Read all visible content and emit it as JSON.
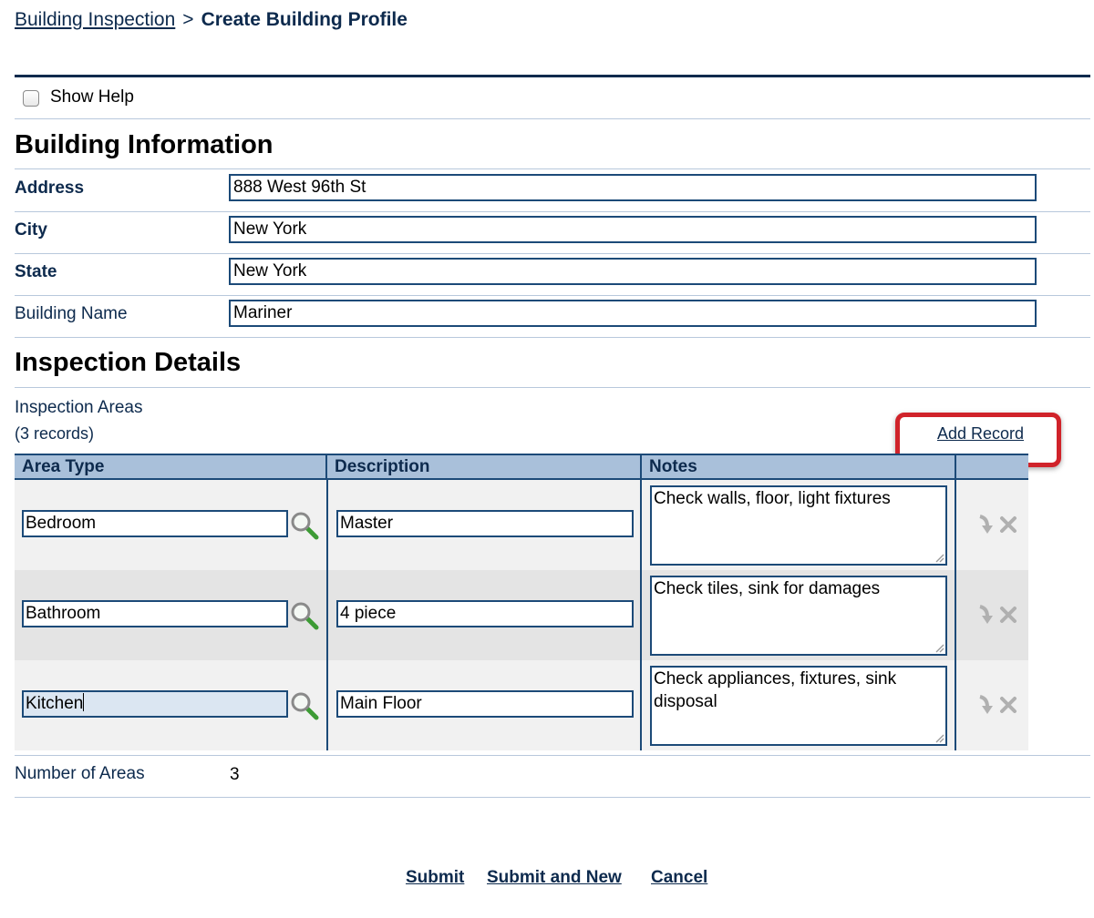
{
  "breadcrumb": {
    "parent": "Building Inspection",
    "separator": ">",
    "current": "Create Building Profile"
  },
  "help": {
    "label": "Show Help",
    "checked": false
  },
  "building_info": {
    "title": "Building Information",
    "fields": [
      {
        "label": "Address",
        "value": "888 West 96th St",
        "required": true
      },
      {
        "label": "City",
        "value": "New York",
        "required": true
      },
      {
        "label": "State",
        "value": "New York",
        "required": true
      },
      {
        "label": "Building Name",
        "value": "Mariner",
        "required": false
      }
    ]
  },
  "inspection": {
    "title": "Inspection Details",
    "areas_label": "Inspection Areas",
    "records_count": "(3 records)",
    "add_record": "Add Record",
    "columns": [
      "Area Type",
      "Description",
      "Notes"
    ],
    "rows": [
      {
        "area_type": "Bedroom",
        "description": "Master",
        "notes": "Check walls, floor, light fixtures"
      },
      {
        "area_type": "Bathroom",
        "description": "4 piece",
        "notes": "Check tiles, sink for damages"
      },
      {
        "area_type": "Kitchen",
        "description": "Main Floor",
        "notes": "Check appliances, fixtures, sink disposal"
      }
    ],
    "number_of_areas_label": "Number of Areas",
    "number_of_areas_value": "3"
  },
  "actions": {
    "submit": "Submit",
    "submit_and_new": "Submit and New",
    "cancel": "Cancel"
  },
  "colors": {
    "navy": "#0d2a4d",
    "header_bg": "#a9c0da",
    "highlight": "#d0232a",
    "lookup_green": "#3d9b35"
  },
  "icons": {
    "lookup": "magnifier-icon",
    "move": "move-down-arrow-icon",
    "delete": "delete-x-icon"
  }
}
